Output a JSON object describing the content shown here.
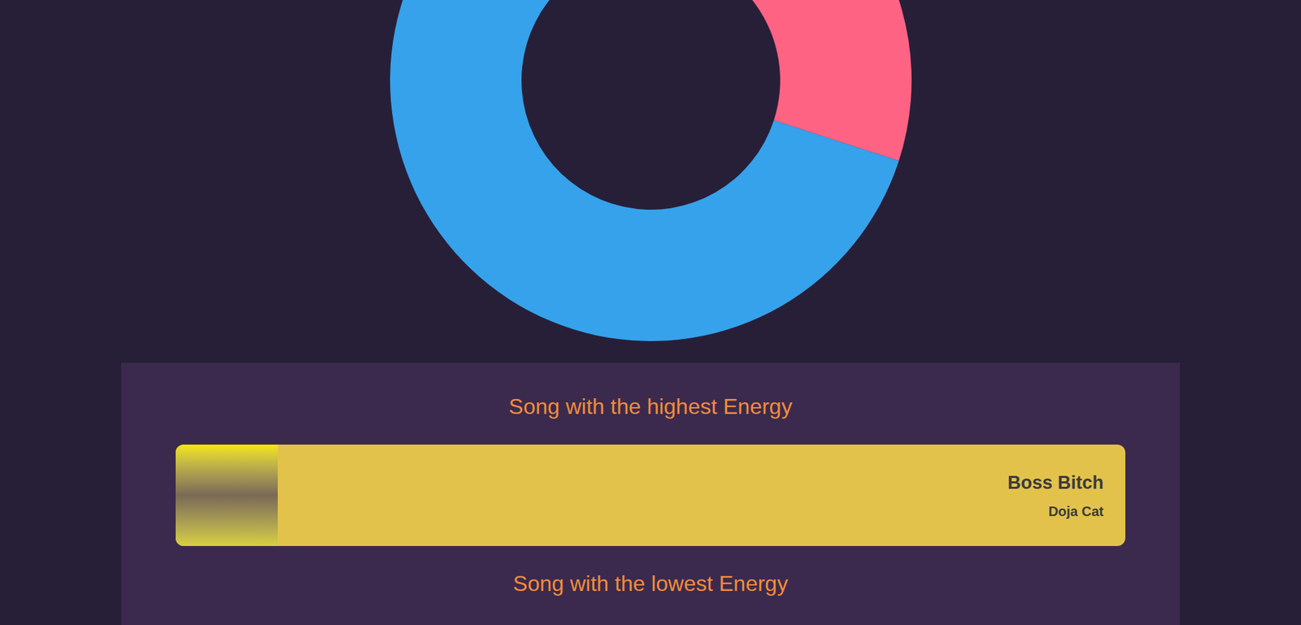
{
  "chart": {
    "segments": [
      {
        "value": 30,
        "color": "#ff6384"
      },
      {
        "value": 70,
        "color": "#36a2eb"
      }
    ]
  },
  "sections": [
    {
      "title": "Song with the highest Energy",
      "song": {
        "title": "Boss Bitch",
        "artist": "Doja Cat"
      }
    },
    {
      "title": "Song with the lowest Energy",
      "song": null
    }
  ]
}
